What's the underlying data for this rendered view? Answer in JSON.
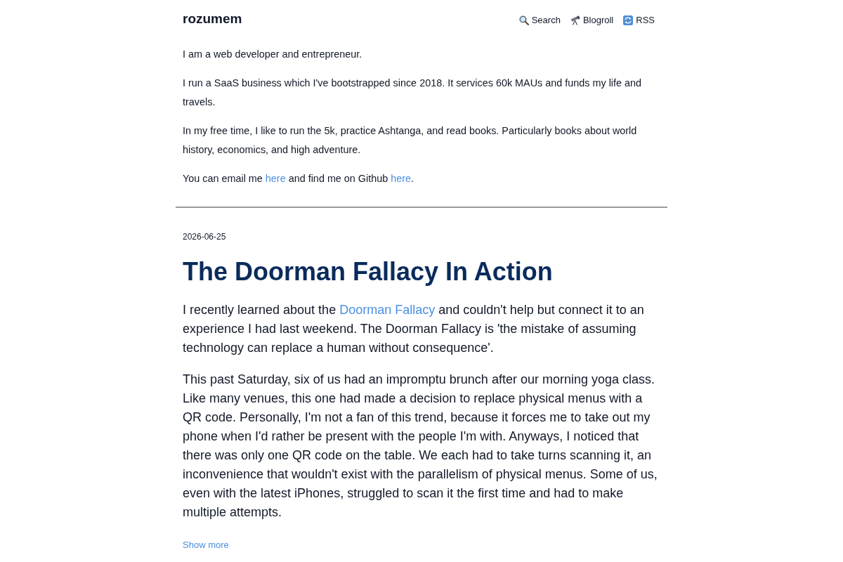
{
  "header": {
    "site_title": "rozumem",
    "nav": [
      {
        "label": "Search"
      },
      {
        "label": "Blogroll"
      },
      {
        "label": "RSS"
      }
    ]
  },
  "intro": {
    "paragraphs": [
      {
        "segments": [
          {
            "kind": "text",
            "text": "I am a web developer and entrepreneur."
          }
        ]
      },
      {
        "segments": [
          {
            "kind": "text",
            "text": "I run a SaaS business which I've bootstrapped since 2018. It services 60k MAUs and funds my life and travels."
          }
        ]
      },
      {
        "segments": [
          {
            "kind": "text",
            "text": "In my free time, I like to run the 5k, practice Ashtanga, and read books. Particularly books about world history, economics, and high adventure."
          }
        ]
      },
      {
        "segments": [
          {
            "kind": "text",
            "text": "You can email me "
          },
          {
            "kind": "link",
            "text": "here"
          },
          {
            "kind": "text",
            "text": " and find me on Github "
          },
          {
            "kind": "link",
            "text": "here"
          },
          {
            "kind": "text",
            "text": "."
          }
        ]
      }
    ]
  },
  "post": {
    "date": "2026-06-25",
    "title": "The Doorman Fallacy In Action",
    "paragraphs": [
      {
        "segments": [
          {
            "kind": "text",
            "text": "I recently learned about the "
          },
          {
            "kind": "link",
            "text": "Doorman Fallacy"
          },
          {
            "kind": "text",
            "text": " and couldn't help but connect it to an experience I had last weekend. The Doorman Fallacy is 'the mistake of assuming technology can replace a human without consequence'."
          }
        ]
      },
      {
        "segments": [
          {
            "kind": "text",
            "text": "This past Saturday, six of us had an impromptu brunch after our morning yoga class. Like many venues, this one had made a decision to replace physical menus with a QR code. Personally, I'm not a fan of this trend, because it forces me to take out my phone when I'd rather be present with the people I'm with. Anyways, I noticed that there was only one QR code on the table. We each had to take turns scanning it, an inconvenience that wouldn't exist with the parallelism of physical menus. Some of us, even with the latest iPhones, struggled to scan it the first time and had to make multiple attempts."
          }
        ]
      }
    ],
    "show_more": "Show more"
  }
}
